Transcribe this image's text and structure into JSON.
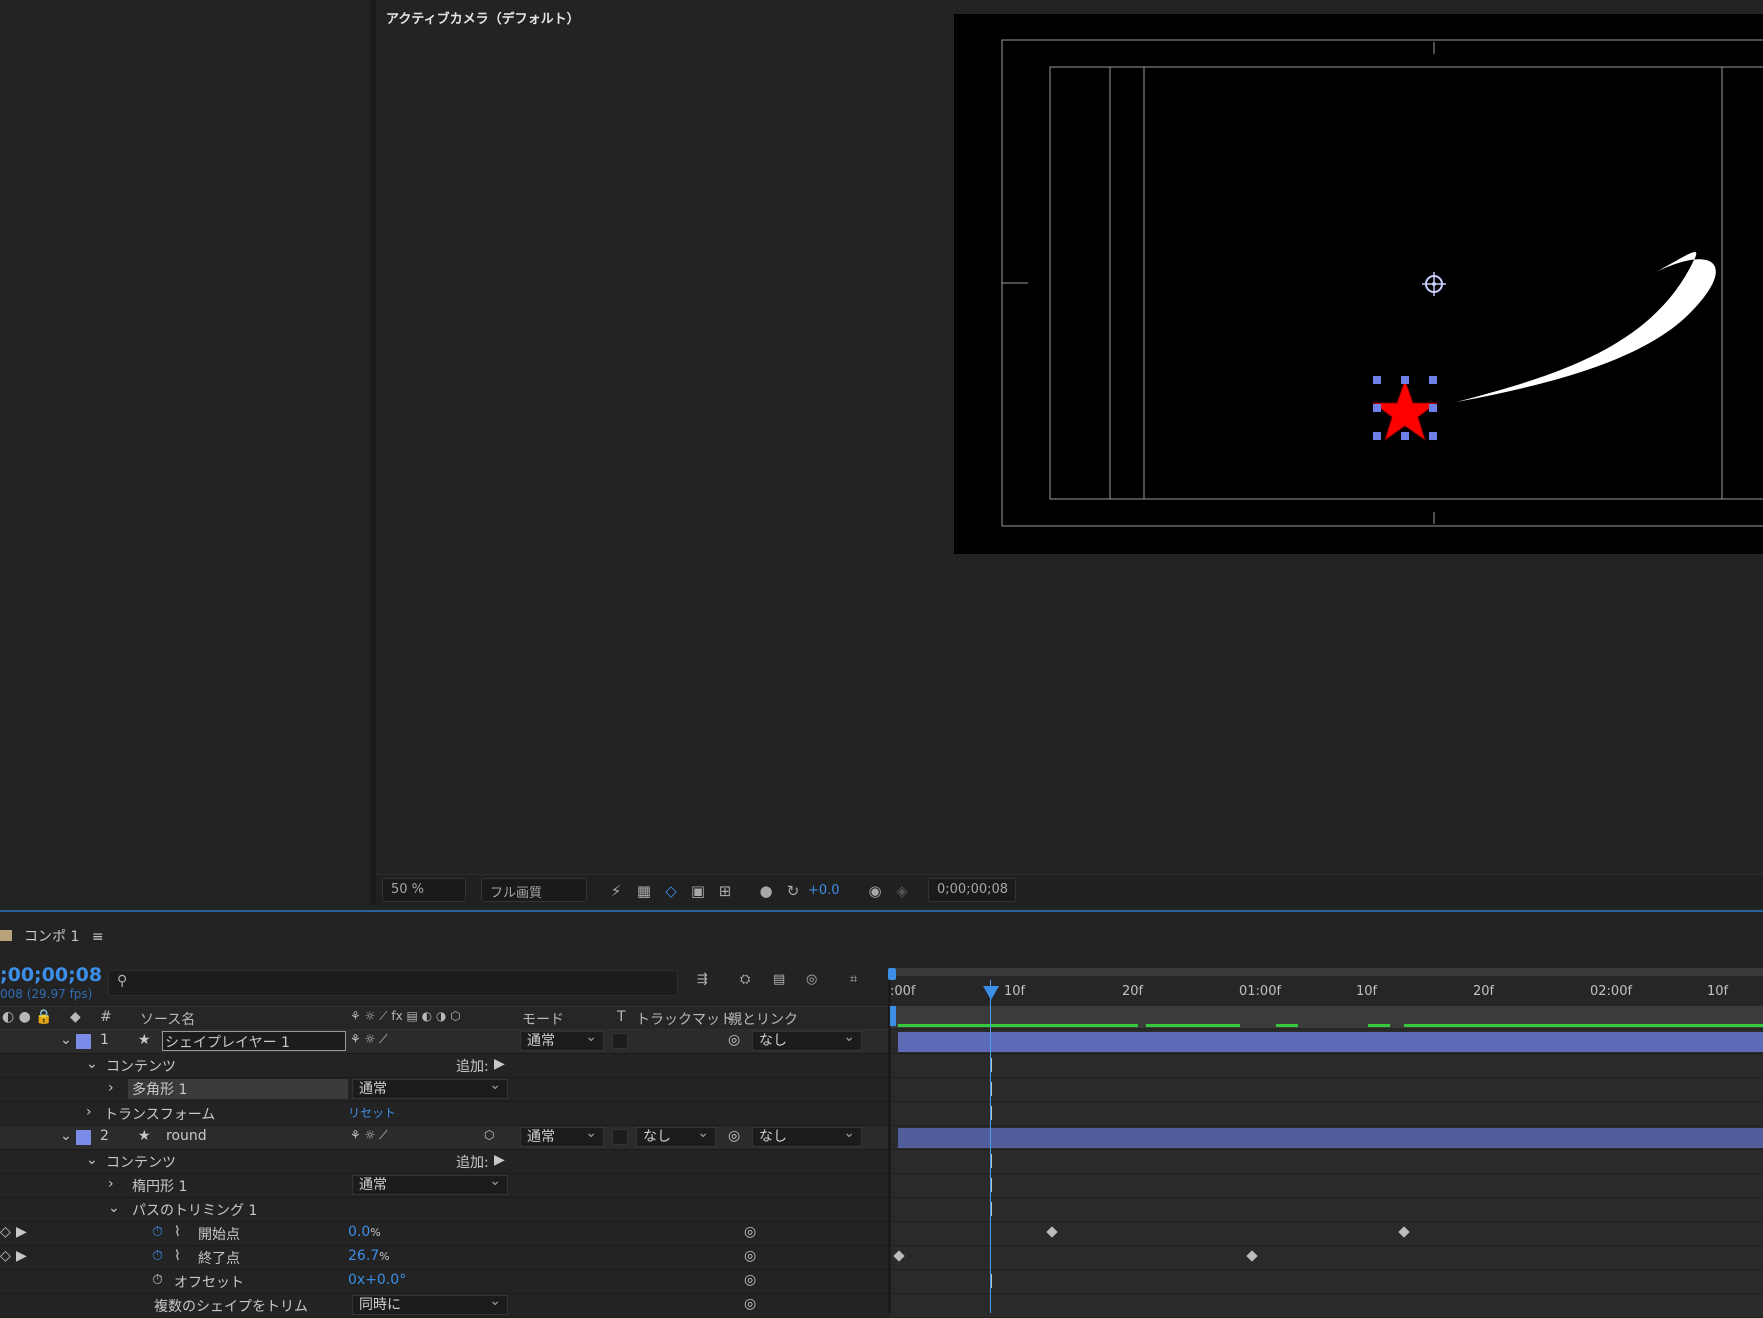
{
  "viewer": {
    "title": "アクティブカメラ（デフォルト）",
    "zoom": "50 %",
    "quality": "フル画質",
    "exposure": "+0.0",
    "timecode": "0;00;00;08"
  },
  "timeline": {
    "tab_label": "コンポ 1",
    "current_time": ";00;00;08",
    "fps_text": "008 (29.97 fps)",
    "ruler_ticks": [
      ":00f",
      "10f",
      "20f",
      "01:00f",
      "10f",
      "20f",
      "02:00f",
      "10f"
    ],
    "headers": {
      "num": "#",
      "source_name": "ソース名",
      "mode": "モード",
      "t": "T",
      "track_matte": "トラックマット",
      "parent": "親とリンク"
    },
    "layers": [
      {
        "index": "1",
        "name": "シェイプレイヤー 1",
        "mode": "通常",
        "parent": "なし",
        "contents_label": "コンテンツ",
        "add_label": "追加:",
        "shape": "多角形 1",
        "shape_mode": "通常",
        "transform_label": "トランスフォーム",
        "reset_label": "リセット"
      },
      {
        "index": "2",
        "name": "round",
        "mode": "通常",
        "track_matte": "なし",
        "parent": "なし",
        "contents_label": "コンテンツ",
        "add_label": "追加:",
        "shape": "楕円形 1",
        "shape_mode": "通常",
        "trim_label": "パスのトリミング 1",
        "start_label": "開始点",
        "start_value": "0.0",
        "start_unit": "%",
        "end_label": "終了点",
        "end_value": "26.7",
        "end_unit": "%",
        "offset_label": "オフセット",
        "offset_value": "0x+0.0°",
        "trim_multiple_label": "複数のシェイプをトリム",
        "trim_multiple_value": "同時に"
      }
    ]
  },
  "colors": {
    "accent": "#3d8ee6",
    "layer_bar": "#5d6bb7",
    "star": "#ff0000",
    "label_swatch": "#7b8ce8"
  }
}
